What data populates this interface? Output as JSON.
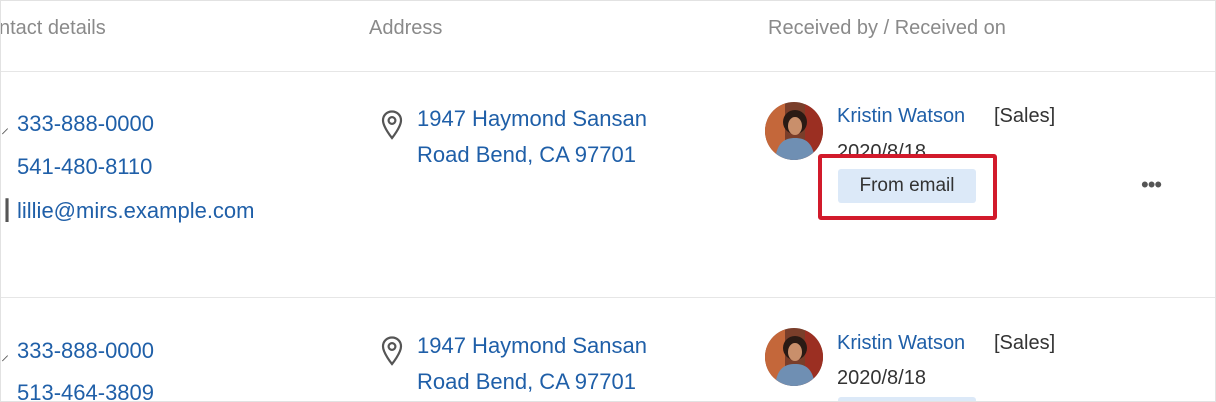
{
  "headers": {
    "contact": "ntact details",
    "address": "Address",
    "received": "Received by / Received on"
  },
  "rows": [
    {
      "phone1": "333-888-0000",
      "phone2": "541-480-8110",
      "email": "lillie@mirs.example.com",
      "address_line1": "1947 Haymond Sansan",
      "address_line2": "Road Bend, CA 97701",
      "receiver_name": "Kristin Watson",
      "receiver_dept": "[Sales]",
      "received_date": "2020/8/18",
      "source_tag": "From email",
      "more": "•••"
    },
    {
      "phone1": "333-888-0000",
      "phone2": "513-464-3809",
      "address_line1": "1947 Haymond Sansan",
      "address_line2": "Road Bend, CA 97701",
      "receiver_name": "Kristin Watson",
      "receiver_dept": "[Sales]",
      "received_date": "2020/8/18"
    }
  ],
  "colors": {
    "link": "#1f5fa8",
    "tag_bg": "#dce9f8",
    "highlight": "#d21a2b"
  },
  "icons": [
    "phone-icon",
    "email-icon",
    "location-pin-icon",
    "more-options-icon"
  ]
}
